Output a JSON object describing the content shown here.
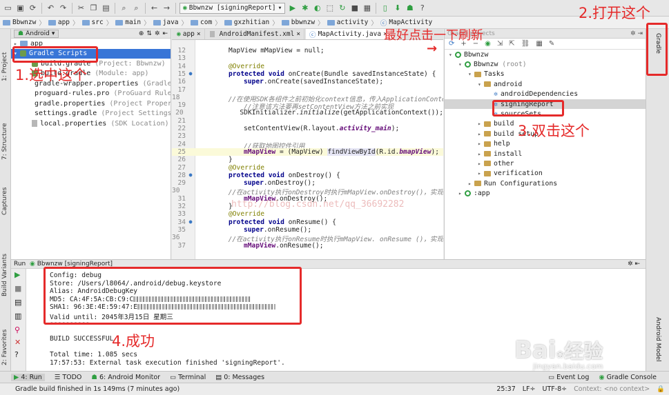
{
  "toolbar": {
    "run_config": "Bbwnzw [signingReport]"
  },
  "breadcrumb": [
    "Bbwnzw",
    "app",
    "src",
    "main",
    "java",
    "com",
    "gxzhitian",
    "bbwnzw",
    "activity",
    "MapActivity"
  ],
  "left_stripe": {
    "project": "1: Project",
    "structure": "7: Structure",
    "captures": "Captures",
    "build_variants": "Build Variants",
    "favorites": "2: Favorites"
  },
  "right_stripe": {
    "gradle": "Gradle",
    "android_model": "Android Model"
  },
  "project_panel": {
    "view_mode": "Android",
    "rows": [
      {
        "name": "app",
        "hint": ""
      },
      {
        "name": "Gradle Scripts",
        "hint": ""
      },
      {
        "name": "build.gradle",
        "hint": "(Project: Bbwnzw)"
      },
      {
        "name": "build.gradle",
        "hint": "(Module: app)"
      },
      {
        "name": "gradle-wrapper.properties",
        "hint": "(Gradle Ve"
      },
      {
        "name": "proguard-rules.pro",
        "hint": "(ProGuard Rules"
      },
      {
        "name": "gradle.properties",
        "hint": "(Project Properti"
      },
      {
        "name": "settings.gradle",
        "hint": "(Project Settings)"
      },
      {
        "name": "local.properties",
        "hint": "(SDK Location)"
      }
    ]
  },
  "editor": {
    "tabs": [
      "app",
      "AndroidManifest.xml",
      "MapActivity.java"
    ],
    "active_tab": "MapActivity.java",
    "line_numbers": [
      "12",
      "13",
      "14",
      "15",
      "16",
      "17",
      "18",
      "19",
      "20",
      "21",
      "22",
      "23",
      "24",
      "25",
      "26",
      "27",
      "28",
      "29",
      "30",
      "31",
      "32",
      "33",
      "34",
      "35",
      "36",
      "37"
    ],
    "lines": {
      "l12": "MapView mMapView = null;",
      "l14": "@Override",
      "l15a": "protected void ",
      "l15b": "onCreate(Bundle savedInstanceState) {",
      "l16a": "super",
      "l16b": ".onCreate(savedInstanceState);",
      "l18": "//在使用SDK各组件之前初始化context信息，传入ApplicationContext",
      "l19": "//注意该方法要再setContentView方法之前实现",
      "l20a": "SDKInitializer.",
      "l20b": "initialize",
      "l20c": "(getApplicationContext());",
      "l22a": "setContentView(R.layout.",
      "l22b": "activity_main",
      "l22c": ");",
      "l24": "//获取地图控件引用",
      "l25a": "mMapView",
      "l25b": " = (MapView) ",
      "l25c": "findViewById",
      "l25d": "(R.id.",
      "l25e": "bmapView",
      "l25f": ");",
      "l26": "}",
      "l27": "@Override",
      "l28a": "protected void ",
      "l28b": "onDestroy() {",
      "l29a": "super",
      "l29b": ".onDestroy();",
      "l30": "//在activity执行onDestroy时执行mMapView.onDestroy()，实现地图",
      "l31a": "mMapView",
      "l31b": ".onDestroy();",
      "l32": "}",
      "l33": "@Override",
      "l34a": "protected void ",
      "l34b": "onResume() {",
      "l35a": "super",
      "l35b": ".onResume();",
      "l36": "//在activity执行onResume时执行mMapView. onResume ()，实现地图",
      "l37a": "mMapView",
      "l37b": ".onResume();"
    }
  },
  "gradle_panel": {
    "title": "Gradle projects",
    "rows": [
      {
        "label": "Bbwnzw",
        "hint": ""
      },
      {
        "label": "Bbwnzw",
        "hint": "(root)"
      },
      {
        "label": "Tasks",
        "hint": ""
      },
      {
        "label": "android",
        "hint": ""
      },
      {
        "label": "androidDependencies",
        "hint": ""
      },
      {
        "label": "signingReport",
        "hint": ""
      },
      {
        "label": "sourceSets",
        "hint": ""
      },
      {
        "label": "build",
        "hint": ""
      },
      {
        "label": "build setup",
        "hint": ""
      },
      {
        "label": "help",
        "hint": ""
      },
      {
        "label": "install",
        "hint": ""
      },
      {
        "label": "other",
        "hint": ""
      },
      {
        "label": "verification",
        "hint": ""
      },
      {
        "label": "Run Configurations",
        "hint": ""
      },
      {
        "label": ":app",
        "hint": ""
      }
    ]
  },
  "run_panel": {
    "label": "Run",
    "config": "Bbwnzw [signingReport]",
    "console": {
      "config": "Config: debug",
      "store": "Store: /Users/l8064/.android/debug.keystore",
      "alias": "Alias: AndroidDebugKey",
      "md5": "MD5: CA:4F:5A:CB:C9:C",
      "sha1": "SHA1: 96:3E:4E:59:47:E",
      "valid": "Valid until: 2045年3月15日 星期三",
      "dashes": "----------",
      "build": "BUILD SUCCESSFUL",
      "total": "Total time: 1.085 secs",
      "finished": "17:57:53: External task execution finished 'signingReport'."
    }
  },
  "bottom_tabs": [
    "4: Run",
    "TODO",
    "6: Android Monitor",
    "Terminal",
    "0: Messages"
  ],
  "bottom_right_tabs": [
    "Event Log",
    "Gradle Console"
  ],
  "status": {
    "message": "Gradle build finished in 1s 149ms (7 minutes ago)",
    "position": "25:37",
    "line_sep": "LF÷",
    "encoding": "UTF-8÷",
    "context": "Context: <no context>"
  },
  "annotations": {
    "step1": "1.选中这个",
    "step2": "2.打开这个",
    "step3": "3.双击这个",
    "step4": "4.成功",
    "refresh_tip": "最好点击一下刷新"
  },
  "watermark": {
    "brand": "Bai",
    "brand_tail": "经验",
    "site": "jingyan.baidu.com",
    "url": "http://blog.csdn.net/qq_36692282"
  }
}
